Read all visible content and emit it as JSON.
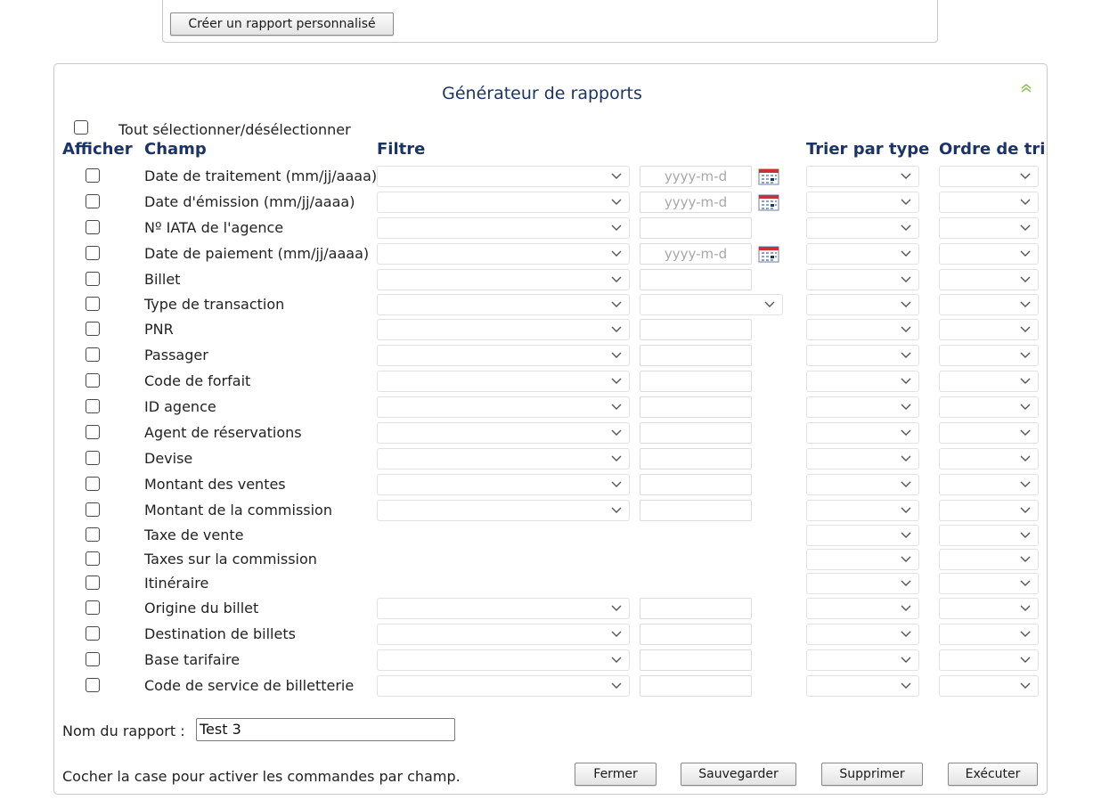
{
  "top": {
    "create_custom_report_label": "Créer un rapport personnalisé"
  },
  "panel": {
    "title": "Générateur de rapports"
  },
  "select_all_label": "Tout sélectionner/désélectionner",
  "headers": {
    "show": "Afficher",
    "field": "Champ",
    "filter": "Filtre",
    "sort_type": "Trier par type",
    "sort_order": "Ordre de tri"
  },
  "date_placeholder": "yyyy-m-d",
  "rows": [
    {
      "label": "Date de traitement (mm/jj/aaaa)",
      "filter": "date"
    },
    {
      "label": "Date d'émission (mm/jj/aaaa)",
      "filter": "date"
    },
    {
      "label": "Nº IATA de l'agence",
      "filter": "text"
    },
    {
      "label": "Date de paiement (mm/jj/aaaa)",
      "filter": "date"
    },
    {
      "label": "Billet",
      "filter": "text"
    },
    {
      "label": "Type de transaction",
      "filter": "select"
    },
    {
      "label": "PNR",
      "filter": "text"
    },
    {
      "label": "Passager",
      "filter": "text"
    },
    {
      "label": "Code de forfait",
      "filter": "text"
    },
    {
      "label": "ID agence",
      "filter": "text"
    },
    {
      "label": "Agent de réservations",
      "filter": "text"
    },
    {
      "label": "Devise",
      "filter": "text"
    },
    {
      "label": "Montant des ventes",
      "filter": "text"
    },
    {
      "label": "Montant de la commission",
      "filter": "text"
    },
    {
      "label": "Taxe de vente",
      "filter": "none"
    },
    {
      "label": "Taxes sur la commission",
      "filter": "none"
    },
    {
      "label": "Itinéraire",
      "filter": "none"
    },
    {
      "label": "Origine du billet",
      "filter": "text"
    },
    {
      "label": "Destination de billets",
      "filter": "text"
    },
    {
      "label": "Base tarifaire",
      "filter": "text"
    },
    {
      "label": "Code de service de billetterie",
      "filter": "text"
    }
  ],
  "report_name": {
    "label": "Nom du rapport :",
    "value": "Test 3"
  },
  "hint": "Cocher la case pour activer les commandes par champ.",
  "buttons": {
    "close": "Fermer",
    "save": "Sauvegarder",
    "delete": "Supprimer",
    "run": "Exécuter"
  }
}
